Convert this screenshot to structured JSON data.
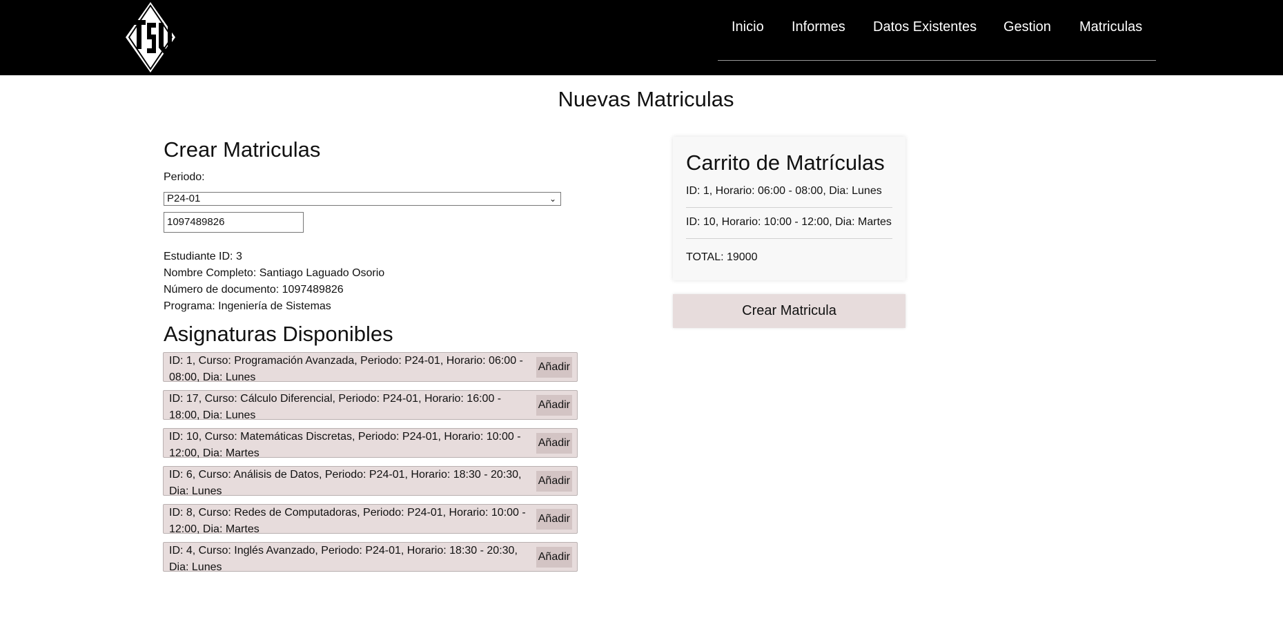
{
  "nav": {
    "logo_text": "TSU",
    "links": [
      "Inicio",
      "Informes",
      "Datos Existentes",
      "Gestion",
      "Matriculas"
    ]
  },
  "page_title": "Nuevas Matriculas",
  "form": {
    "heading": "Crear Matriculas",
    "periodo_label": "Periodo:",
    "periodo_value": "P24-01",
    "documento_value": "1097489826"
  },
  "student": {
    "id_line": "Estudiante ID: 3",
    "name_line": "Nombre Completo: Santiago Laguado Osorio",
    "doc_line": "Número de documento: 1097489826",
    "program_line": "Programa: Ingeniería de Sistemas"
  },
  "courses": {
    "heading": "Asignaturas Disponibles",
    "add_label": "Añadir",
    "items": [
      "ID: 1, Curso: Programación Avanzada, Periodo: P24-01, Horario: 06:00 - 08:00, Dia: Lunes",
      "ID: 17, Curso: Cálculo Diferencial, Periodo: P24-01, Horario: 16:00 - 18:00, Dia: Lunes",
      "ID: 10, Curso: Matemáticas Discretas, Periodo: P24-01, Horario: 10:00 - 12:00, Dia: Martes",
      "ID: 6, Curso: Análisis de Datos, Periodo: P24-01, Horario: 18:30 - 20:30, Dia: Lunes",
      "ID: 8, Curso: Redes de Computadoras, Periodo: P24-01, Horario: 10:00 - 12:00, Dia: Martes",
      "ID: 4, Curso: Inglés Avanzado, Periodo: P24-01, Horario: 18:30 - 20:30, Dia: Lunes"
    ]
  },
  "cart": {
    "title": "Carrito de Matrículas",
    "items": [
      "ID: 1, Horario: 06:00 - 08:00, Dia: Lunes",
      "ID: 10, Horario: 10:00 - 12:00, Dia: Martes"
    ],
    "total": "TOTAL: 19000"
  },
  "create_button": "Crear Matricula",
  "colors": {
    "header_bg": "#000000",
    "row_bg": "#e7dcdc",
    "add_btn_bg": "#d3c4c4"
  }
}
